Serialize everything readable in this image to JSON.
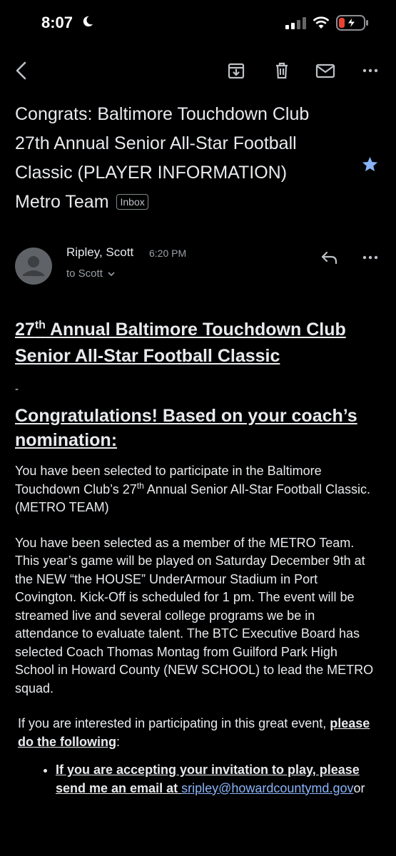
{
  "status_bar": {
    "time": "8:07"
  },
  "email": {
    "subject": "Congrats: Baltimore Touchdown Club 27th Annual Senior All-Star Football Classic (PLAYER INFORMATION) Metro Team",
    "label": "Inbox",
    "sender": "Ripley, Scott",
    "time": "6:20 PM",
    "to": "to Scott",
    "heading": {
      "part1": "27",
      "sup": "th",
      "part2": " Annual Baltimore Touchdown Club Senior All-Star Football Classic"
    },
    "dash": "-",
    "congrats": "Congratulations! Based on your coach’s nomination:",
    "p1": {
      "a": "You have been selected to participate in the Baltimore Touchdown Club’s 27",
      "sup": "th",
      "b": " Annual Senior All-Star Football Classic. (METRO TEAM)"
    },
    "p2": "You have been selected as a member of the METRO Team. This year’s game will be played on Saturday December 9th at the NEW “the HOUSE” UnderArmour Stadium in Port Covington. Kick-Off is scheduled for 1 pm. The event will be streamed live and several college programs we be in attendance to evaluate talent. The BTC Executive Board has selected Coach Thomas Montag from Guilford Park High School in Howard County (NEW SCHOOL) to lead the METRO squad.",
    "p3": {
      "a": "If you are interested in participating in this great event, ",
      "bold": "please do the following",
      "b": ":"
    },
    "bullet1": {
      "text": "If you are accepting your invitation to play, please send me an email at ",
      "email": "sripley@howardcountymd.gov",
      "after": " or"
    }
  },
  "colors": {
    "accent_star": "#8ab4f8",
    "background": "#000000",
    "battery_low": "#ea4335"
  }
}
